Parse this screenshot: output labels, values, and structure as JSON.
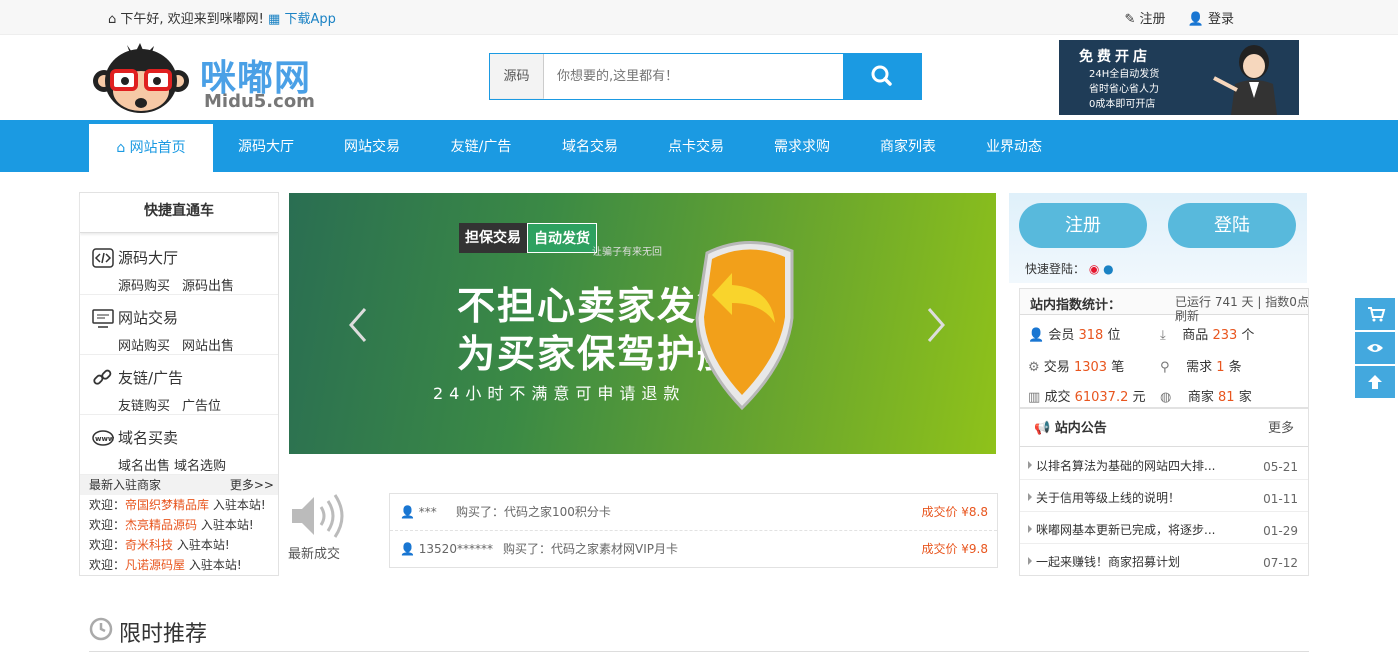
{
  "topbar": {
    "greeting": "下午好, 欢迎来到咪嘟网!",
    "app": "下载App",
    "register": "注册",
    "login": "登录"
  },
  "logo": {
    "cn": "咪嘟网",
    "en": "Midu5.com"
  },
  "search": {
    "category": "源码",
    "placeholder": "你想要的,这里都有！"
  },
  "ad": {
    "title": "免费开店",
    "lines": [
      "24H全自动发货",
      "省时省心省人力",
      "0成本即可开店"
    ]
  },
  "nav": [
    "网站首页",
    "源码大厅",
    "网站交易",
    "友链/广告",
    "域名交易",
    "点卡交易",
    "需求求购",
    "商家列表",
    "业界动态"
  ],
  "sidebar": {
    "title": "快捷直通车",
    "cats": [
      {
        "title": "源码大厅",
        "subs": [
          "源码购买",
          "源码出售"
        ]
      },
      {
        "title": "网站交易",
        "subs": [
          "网站购买",
          "网站出售"
        ]
      },
      {
        "title": "友链/广告",
        "subs": [
          "友链购买",
          "广告位"
        ]
      },
      {
        "title": "域名买卖",
        "subs": [
          "域名出售",
          "域名选购"
        ]
      }
    ],
    "merchants_title": "最新入驻商家",
    "merchants_more": "更多>>",
    "merchants": [
      {
        "pre": "欢迎：",
        "name": "帝国织梦精品库",
        "post": " 入驻本站!"
      },
      {
        "pre": "欢迎：",
        "name": "杰亮精品源码",
        "post": " 入驻本站!"
      },
      {
        "pre": "欢迎：",
        "name": "奇米科技",
        "post": " 入驻本站!"
      },
      {
        "pre": "欢迎：",
        "name": "凡诺源码屋",
        "post": " 入驻本站!"
      }
    ]
  },
  "banner": {
    "tag1": "担保交易",
    "tag2": "自动发货",
    "tag3": "让骗子有来无回",
    "line1": "不担心卖家发货",
    "line2": "为买家保驾护航",
    "line3": "24小时不满意可申请退款"
  },
  "deals": {
    "label": "最新成交",
    "rows": [
      {
        "user": "*** ",
        "desc": "购买了：代码之家100积分卡",
        "price": "成交价 ¥8.8"
      },
      {
        "user": "13520******",
        "desc": "购买了：代码之家素材网VIP月卡",
        "price": "成交价 ¥9.8"
      }
    ]
  },
  "right": {
    "register": "注册",
    "login": "登陆",
    "quick_login": "快速登陆：",
    "stats_title": "站内指数统计：",
    "run_info": "已运行 741 天 | 指数0点刷新",
    "stats": [
      {
        "label": "会员",
        "value": "318",
        "unit": "位"
      },
      {
        "label": "商品",
        "value": "233",
        "unit": "个"
      },
      {
        "label": "交易",
        "value": "1303",
        "unit": "笔"
      },
      {
        "label": "需求",
        "value": "1",
        "unit": "条"
      },
      {
        "label": "成交",
        "value": "61037.2",
        "unit": "元"
      },
      {
        "label": "商家",
        "value": "81",
        "unit": "家"
      }
    ],
    "notice_title": "站内公告",
    "notice_more": "更多",
    "notices": [
      {
        "text": "以排名算法为基础的网站四大排...",
        "date": "05-21"
      },
      {
        "text": "关于信用等级上线的说明！",
        "date": "01-11"
      },
      {
        "text": "咪嘟网基本更新已完成，将逐步...",
        "date": "01-29"
      },
      {
        "text": "一起来赚钱！商家招募计划",
        "date": "07-12"
      }
    ]
  },
  "section": {
    "title": "限时推荐"
  },
  "colors": {
    "primary": "#1b9ae2",
    "accent": "#e8561f"
  }
}
